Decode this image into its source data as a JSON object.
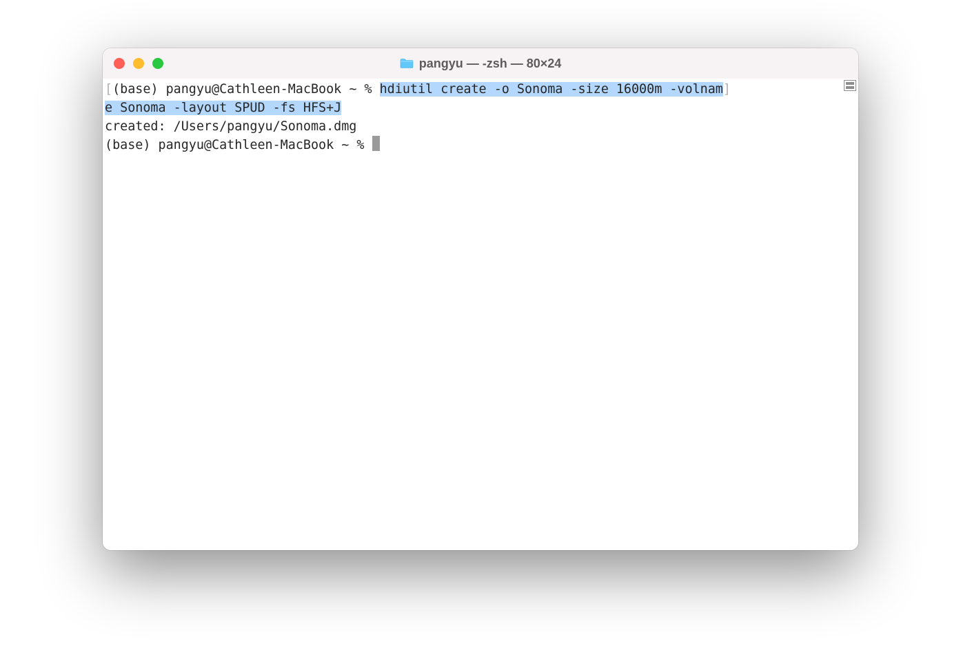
{
  "titlebar": {
    "title": "pangyu — -zsh — 80×24"
  },
  "terminal": {
    "line1_bracket_open": "[",
    "line1_prompt": "(base) pangyu@Cathleen-MacBook ~ % ",
    "line1_cmd_part1": "hdiutil create -o Sonoma -size 16000m -volnam",
    "line1_bracket_close": "]",
    "line2_cmd_part2": "e Sonoma -layout SPUD -fs HFS+J",
    "line3_output": "created: /Users/pangyu/Sonoma.dmg",
    "line4_prompt": "(base) pangyu@Cathleen-MacBook ~ % "
  },
  "colors": {
    "selection_bg": "#b4d8fd",
    "titlebar_bg": "#f7f2f3",
    "close": "#ff5f57",
    "minimize": "#febc2e",
    "maximize": "#28c840"
  }
}
